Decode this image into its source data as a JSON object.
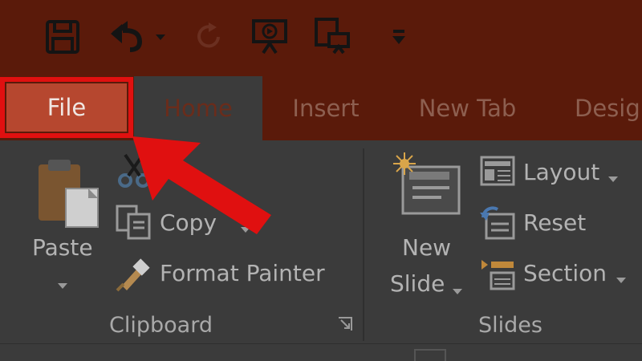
{
  "quick_access": {
    "icons": [
      "save-icon",
      "undo-icon",
      "undo-dropdown-icon",
      "redo-icon",
      "slideshow-icon",
      "present-icon",
      "customize-icon"
    ]
  },
  "tabs": {
    "file": "File",
    "home": "Home",
    "insert": "Insert",
    "new_tab": "New Tab",
    "design": "Desig"
  },
  "clipboard": {
    "paste": "Paste",
    "copy": "Copy",
    "format_painter": "Format Painter",
    "group_label": "Clipboard"
  },
  "slides": {
    "new_slide_line1": "New",
    "new_slide_line2": "Slide",
    "layout": "Layout",
    "reset": "Reset",
    "section": "Section",
    "group_label": "Slides"
  },
  "colors": {
    "title_bar": "#5a1a0a",
    "file_tab": "#b6472f",
    "highlight": "#e01010",
    "ribbon": "#3b3b3b"
  }
}
